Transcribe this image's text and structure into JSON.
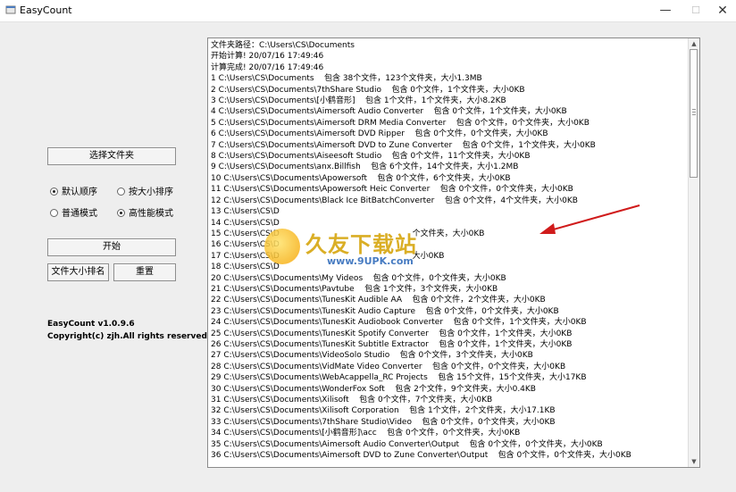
{
  "window": {
    "title": "EasyCount",
    "min": "—",
    "max": "☐",
    "close": "✕"
  },
  "left": {
    "select_folder": "选择文件夹",
    "radio_default": "默认顺序",
    "radio_size": "按大小排序",
    "radio_normal": "普通模式",
    "radio_highperf": "高性能模式",
    "start": "开始",
    "rank_size": "文件大小排名",
    "reset": "重置",
    "version": "EasyCount v1.0.9.6",
    "copyright": "Copyright(c) zjh.All rights reserved."
  },
  "output": {
    "lines": [
      "文件夹路径：C:\\Users\\CS\\Documents",
      "开始计算! 20/07/16 17:49:46",
      "计算完成! 20/07/16 17:49:46",
      "1 C:\\Users\\CS\\Documents    包含 38个文件，123个文件夹，大小1.3MB",
      "2 C:\\Users\\CS\\Documents\\7thShare Studio    包含 0个文件，1个文件夹，大小0KB",
      "3 C:\\Users\\CS\\Documents\\[小鹤音形]    包含 1个文件，1个文件夹，大小8.2KB",
      "4 C:\\Users\\CS\\Documents\\Aimersoft Audio Converter    包含 0个文件，1个文件夹，大小0KB",
      "5 C:\\Users\\CS\\Documents\\Aimersoft DRM Media Converter    包含 0个文件，0个文件夹，大小0KB",
      "6 C:\\Users\\CS\\Documents\\Aimersoft DVD Ripper    包含 0个文件，0个文件夹，大小0KB",
      "7 C:\\Users\\CS\\Documents\\Aimersoft DVD to Zune Converter    包含 0个文件，1个文件夹，大小0KB",
      "8 C:\\Users\\CS\\Documents\\Aiseesoft Studio    包含 0个文件，11个文件夹，大小0KB",
      "9 C:\\Users\\CS\\Documents\\anx.Billfish    包含 6个文件，14个文件夹，大小1.2MB",
      "10 C:\\Users\\CS\\Documents\\Apowersoft    包含 0个文件，6个文件夹，大小0KB",
      "11 C:\\Users\\CS\\Documents\\Apowersoft Heic Converter    包含 0个文件，0个文件夹，大小0KB",
      "12 C:\\Users\\CS\\Documents\\Black Ice BitBatchConverter    包含 0个文件，4个文件夹，大小0KB",
      "13 C:\\Users\\CS\\D",
      "14 C:\\Users\\CS\\D",
      "15 C:\\Users\\CS\\D                                                    个文件夹，大小0KB",
      "16 C:\\Users\\CS\\D",
      "17 C:\\Users\\CS\\D                                                    大小0KB",
      "18 C:\\Users\\CS\\D",
      "20 C:\\Users\\CS\\Documents\\My Videos    包含 0个文件，0个文件夹，大小0KB",
      "21 C:\\Users\\CS\\Documents\\Pavtube    包含 1个文件，3个文件夹，大小0KB",
      "22 C:\\Users\\CS\\Documents\\TunesKit Audible AA    包含 0个文件，2个文件夹，大小0KB",
      "23 C:\\Users\\CS\\Documents\\TunesKit Audio Capture    包含 0个文件，0个文件夹，大小0KB",
      "24 C:\\Users\\CS\\Documents\\TunesKit Audiobook Converter    包含 0个文件，1个文件夹，大小0KB",
      "25 C:\\Users\\CS\\Documents\\TunesKit Spotify Converter    包含 0个文件，1个文件夹，大小0KB",
      "26 C:\\Users\\CS\\Documents\\TunesKit Subtitle Extractor    包含 0个文件，1个文件夹，大小0KB",
      "27 C:\\Users\\CS\\Documents\\VideoSolo Studio    包含 0个文件，3个文件夹，大小0KB",
      "28 C:\\Users\\CS\\Documents\\VidMate Video Converter    包含 0个文件，0个文件夹，大小0KB",
      "29 C:\\Users\\CS\\Documents\\WebAcappella_RC Projects    包含 15个文件，15个文件夹，大小17KB",
      "30 C:\\Users\\CS\\Documents\\WonderFox Soft    包含 2个文件，9个文件夹，大小0.4KB",
      "31 C:\\Users\\CS\\Documents\\Xilisoft    包含 0个文件，7个文件夹，大小0KB",
      "32 C:\\Users\\CS\\Documents\\Xilisoft Corporation    包含 1个文件，2个文件夹，大小17.1KB",
      "33 C:\\Users\\CS\\Documents\\7thShare Studio\\Video    包含 0个文件，0个文件夹，大小0KB",
      "34 C:\\Users\\CS\\Documents\\[小鹤音形]\\acc    包含 0个文件，0个文件夹，大小0KB",
      "35 C:\\Users\\CS\\Documents\\Aimersoft Audio Converter\\Output    包含 0个文件，0个文件夹，大小0KB",
      "36 C:\\Users\\CS\\Documents\\Aimersoft DVD to Zune Converter\\Output    包含 0个文件，0个文件夹，大小0KB"
    ]
  },
  "watermark": {
    "main": "久友下载站",
    "url": "www.9UPK.com"
  },
  "colors": {
    "arrow": "#d01b1b",
    "watermark": "#d4a000",
    "url": "#2966b8"
  }
}
